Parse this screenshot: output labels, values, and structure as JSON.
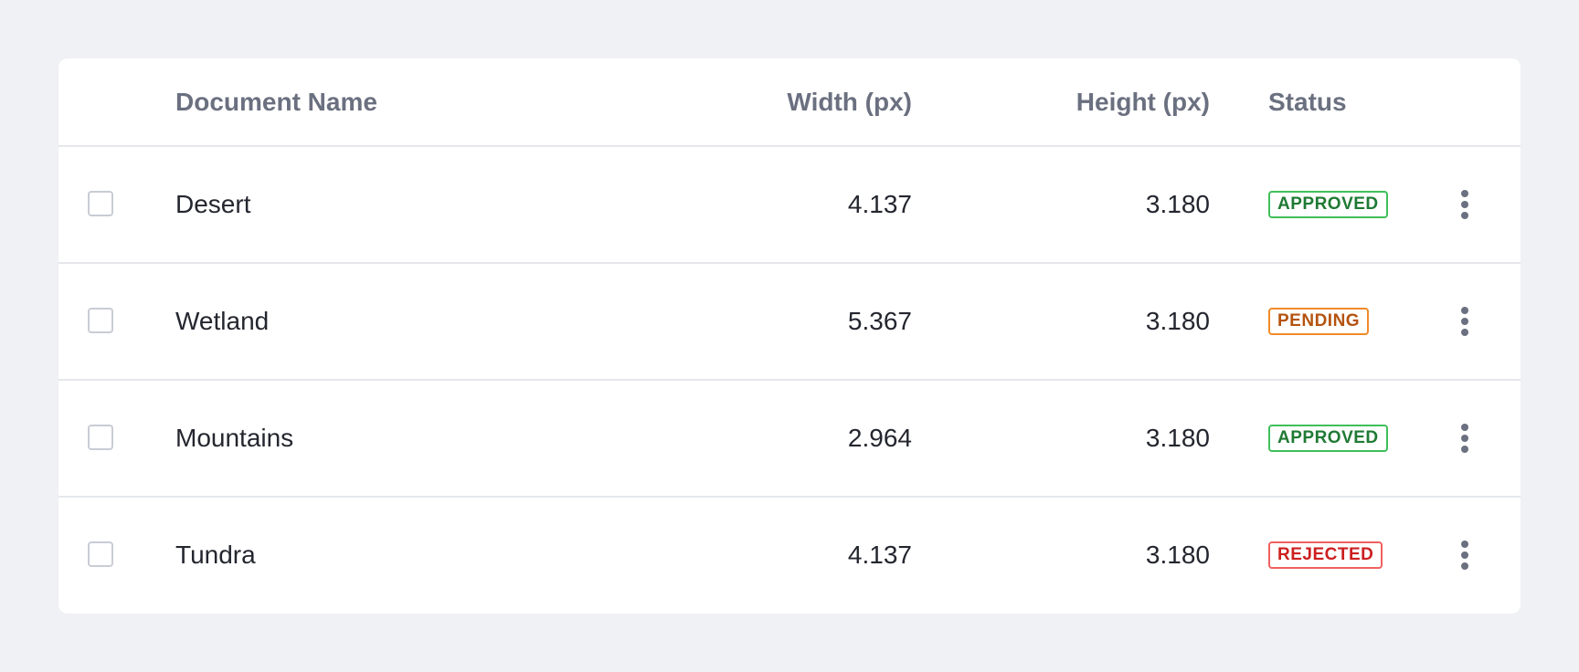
{
  "table": {
    "headers": {
      "name": "Document Name",
      "width": "Width (px)",
      "height": "Height (px)",
      "status": "Status"
    },
    "rows": [
      {
        "name": "Desert",
        "width": "4.137",
        "height": "3.180",
        "status": "APPROVED"
      },
      {
        "name": "Wetland",
        "width": "5.367",
        "height": "3.180",
        "status": "PENDING"
      },
      {
        "name": "Mountains",
        "width": "2.964",
        "height": "3.180",
        "status": "APPROVED"
      },
      {
        "name": "Tundra",
        "width": "4.137",
        "height": "3.180",
        "status": "REJECTED"
      }
    ]
  },
  "colors": {
    "background": "#f0f1f4",
    "approved": "#3fbf5a",
    "pending": "#f08a2a",
    "rejected": "#f06060"
  },
  "icons": {
    "row_menu": "more-vertical-icon"
  }
}
